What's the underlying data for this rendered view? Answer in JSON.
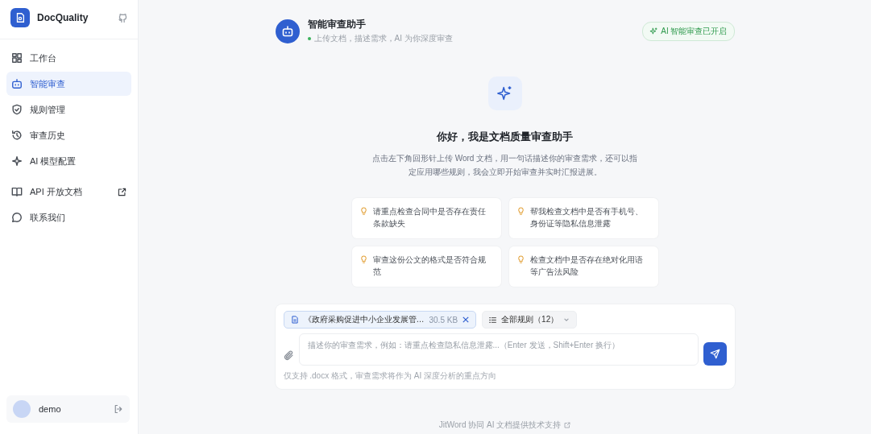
{
  "sidebar": {
    "brand": "DocQuality",
    "sections": [
      {
        "items": [
          {
            "label": "工作台",
            "selected": false
          },
          {
            "label": "智能审查",
            "selected": true
          },
          {
            "label": "规则管理",
            "selected": false
          },
          {
            "label": "审查历史",
            "selected": false
          },
          {
            "label": "AI 模型配置",
            "selected": false
          }
        ]
      },
      {
        "items": [
          {
            "label": "API 开放文档",
            "selected": false,
            "external": true
          },
          {
            "label": "联系我们",
            "selected": false,
            "external": false
          }
        ]
      }
    ],
    "user": {
      "name": "demo"
    }
  },
  "header": {
    "title": "智能审查助手",
    "subtitle": "上传文档，描述需求，AI 为你深度审查",
    "status": "AI 智能审查已开启"
  },
  "hero": {
    "title": "你好，我是文档质量审查助手",
    "description": "点击左下角回形针上传 Word 文档，用一句话描述你的审查需求，还可以指定应用哪些规则，我会立即开始审查并实时汇报进展。"
  },
  "suggestions": [
    "请重点检查合同中是否存在责任条款缺失",
    "帮我检查文档中是否有手机号、身份证等隐私信息泄露",
    "审查这份公文的格式是否符合规范",
    "检查文档中是否存在绝对化用语等广告法风险"
  ],
  "composer": {
    "file": {
      "name": "《政府采购促进中小企业发展管…",
      "size": "30.5 KB"
    },
    "rules": "全部规则（12）",
    "placeholder": "描述你的审查需求，例如：请重点检查隐私信息泄露...（Enter 发送，Shift+Enter 换行）",
    "hint": "仅支持 .docx 格式，审查需求将作为 AI 深度分析的重点方向"
  },
  "footer": "JitWord 协同 AI 文档提供技术支持"
}
